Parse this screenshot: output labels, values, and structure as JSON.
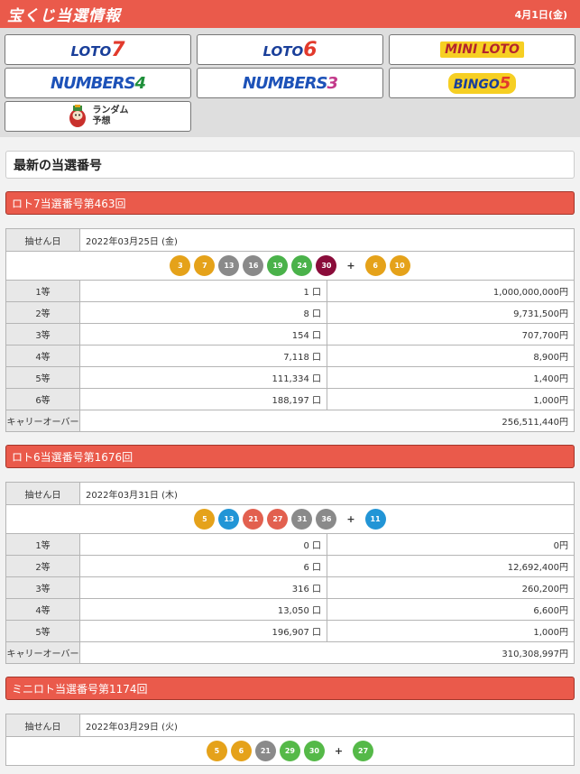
{
  "header": {
    "title": "宝くじ当選情報",
    "date": "4月1日(金)"
  },
  "logos": {
    "loto7": {
      "text": "LOTO",
      "num": "7"
    },
    "loto6": {
      "text": "LOTO",
      "num": "6"
    },
    "miniloto": {
      "text": "MINI LOTO"
    },
    "numbers4": {
      "text": "NUMBERS",
      "num": "4"
    },
    "numbers3": {
      "text": "NUMBERS",
      "num": "3"
    },
    "bingo5": {
      "text": "BINGO",
      "num": "5"
    },
    "random": {
      "line1": "ランダム",
      "line2": "予想"
    }
  },
  "latest_title": "最新の当選番号",
  "colors": {
    "accent": "#ea5a4b"
  },
  "labels": {
    "draw_date": "抽せん日",
    "carryover": "キャリーオーバー",
    "plus": "+"
  },
  "loto7": {
    "head": "ロト7当選番号第463回",
    "date": "2022年03月25日 (金)",
    "main_balls": [
      {
        "n": "3",
        "c": "c-yellow"
      },
      {
        "n": "7",
        "c": "c-yellow"
      },
      {
        "n": "13",
        "c": "c-gray"
      },
      {
        "n": "16",
        "c": "c-gray"
      },
      {
        "n": "19",
        "c": "c-green"
      },
      {
        "n": "24",
        "c": "c-green"
      },
      {
        "n": "30",
        "c": "c-maroon"
      }
    ],
    "bonus_balls": [
      {
        "n": "6",
        "c": "c-yellow"
      },
      {
        "n": "10",
        "c": "c-yellow"
      }
    ],
    "prizes": [
      {
        "rank": "1等",
        "count": "1 口",
        "amount": "1,000,000,000円"
      },
      {
        "rank": "2等",
        "count": "8 口",
        "amount": "9,731,500円"
      },
      {
        "rank": "3等",
        "count": "154 口",
        "amount": "707,700円"
      },
      {
        "rank": "4等",
        "count": "7,118 口",
        "amount": "8,900円"
      },
      {
        "rank": "5等",
        "count": "111,334 口",
        "amount": "1,400円"
      },
      {
        "rank": "6等",
        "count": "188,197 口",
        "amount": "1,000円"
      }
    ],
    "carryover": "256,511,440円"
  },
  "loto6": {
    "head": "ロト6当選番号第1676回",
    "date": "2022年03月31日 (木)",
    "main_balls": [
      {
        "n": "5",
        "c": "c-yellow"
      },
      {
        "n": "13",
        "c": "c-blue"
      },
      {
        "n": "21",
        "c": "c-red"
      },
      {
        "n": "27",
        "c": "c-red"
      },
      {
        "n": "31",
        "c": "c-gray"
      },
      {
        "n": "36",
        "c": "c-gray"
      }
    ],
    "bonus_balls": [
      {
        "n": "11",
        "c": "c-blue"
      }
    ],
    "prizes": [
      {
        "rank": "1等",
        "count": "0 口",
        "amount": "0円"
      },
      {
        "rank": "2等",
        "count": "6 口",
        "amount": "12,692,400円"
      },
      {
        "rank": "3等",
        "count": "316 口",
        "amount": "260,200円"
      },
      {
        "rank": "4等",
        "count": "13,050 口",
        "amount": "6,600円"
      },
      {
        "rank": "5等",
        "count": "196,907 口",
        "amount": "1,000円"
      }
    ],
    "carryover": "310,308,997円"
  },
  "miniloto": {
    "head": "ミニロト当選番号第1174回",
    "date": "2022年03月29日 (火)",
    "main_balls": [
      {
        "n": "5",
        "c": "c-yellow"
      },
      {
        "n": "6",
        "c": "c-yellow"
      },
      {
        "n": "21",
        "c": "c-gray"
      },
      {
        "n": "29",
        "c": "c-lgreen"
      },
      {
        "n": "30",
        "c": "c-lgreen"
      }
    ],
    "bonus_balls": [
      {
        "n": "27",
        "c": "c-lgreen"
      }
    ]
  }
}
